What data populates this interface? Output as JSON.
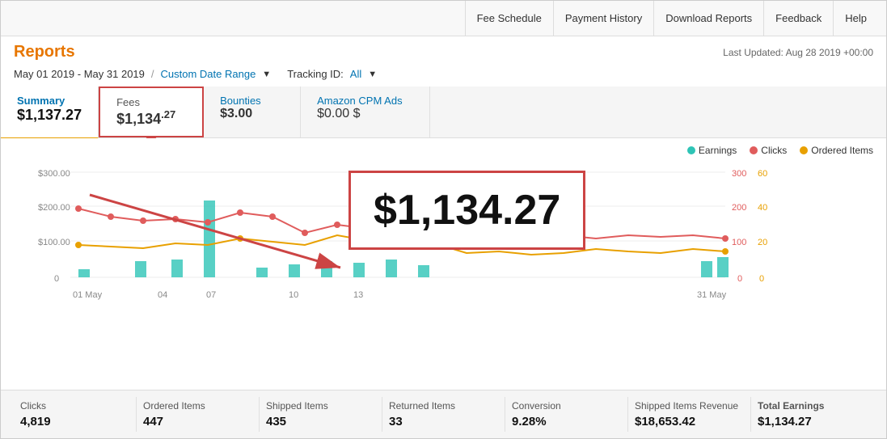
{
  "app": {
    "title": "Reports"
  },
  "nav": {
    "items": [
      {
        "id": "fee-schedule",
        "label": "Fee Schedule"
      },
      {
        "id": "payment-history",
        "label": "Payment History"
      },
      {
        "id": "download-reports",
        "label": "Download Reports"
      },
      {
        "id": "feedback",
        "label": "Feedback"
      },
      {
        "id": "help",
        "label": "Help"
      }
    ]
  },
  "filters": {
    "date_range": "May 01 2019 - May 31 2019",
    "separator": "/",
    "custom_date_label": "Custom Date Range",
    "tracking_label": "Tracking ID:",
    "tracking_value": "All",
    "last_updated": "Last Updated: Aug 28 2019 +00:00"
  },
  "tabs": {
    "summary": {
      "label": "Summary",
      "value": "$1,137.27"
    },
    "fees": {
      "label": "Fees",
      "value": "$1,134",
      "cents": ".27"
    },
    "bounties": {
      "label": "Bounties",
      "value": "$3.00"
    },
    "amazon_cpm": {
      "label": "Amazon CPM Ads",
      "value": "$0.00 $"
    }
  },
  "chart": {
    "legend": [
      {
        "id": "earnings",
        "label": "Earnings",
        "color": "#2ec4b6"
      },
      {
        "id": "clicks",
        "label": "Clicks",
        "color": "#e05c5c"
      },
      {
        "id": "ordered-items",
        "label": "Ordered Items",
        "color": "#e8a000"
      }
    ],
    "y_left_labels": [
      "$300.00",
      "$200.00",
      "$100.00",
      "0"
    ],
    "y_right_labels_clicks": [
      "300",
      "200",
      "100",
      "0"
    ],
    "y_right_labels_orders": [
      "60",
      "40",
      "20",
      "0"
    ],
    "x_labels": [
      "01 May",
      "04",
      "07",
      "10",
      "13",
      "31 May"
    ]
  },
  "big_value": {
    "amount": "$1,134.27"
  },
  "fees_box_label": "Fees",
  "stats": [
    {
      "id": "clicks",
      "label": "Clicks",
      "value": "4,819"
    },
    {
      "id": "ordered-items",
      "label": "Ordered Items",
      "value": "447"
    },
    {
      "id": "shipped-items",
      "label": "Shipped Items",
      "value": "435"
    },
    {
      "id": "returned-items",
      "label": "Returned Items",
      "value": "33"
    },
    {
      "id": "conversion",
      "label": "Conversion",
      "value": "9.28%"
    },
    {
      "id": "shipped-items-revenue",
      "label": "Shipped Items Revenue",
      "value": "$18,653.42"
    },
    {
      "id": "total-earnings",
      "label": "Total Earnings",
      "value": "$1,134.27"
    }
  ]
}
